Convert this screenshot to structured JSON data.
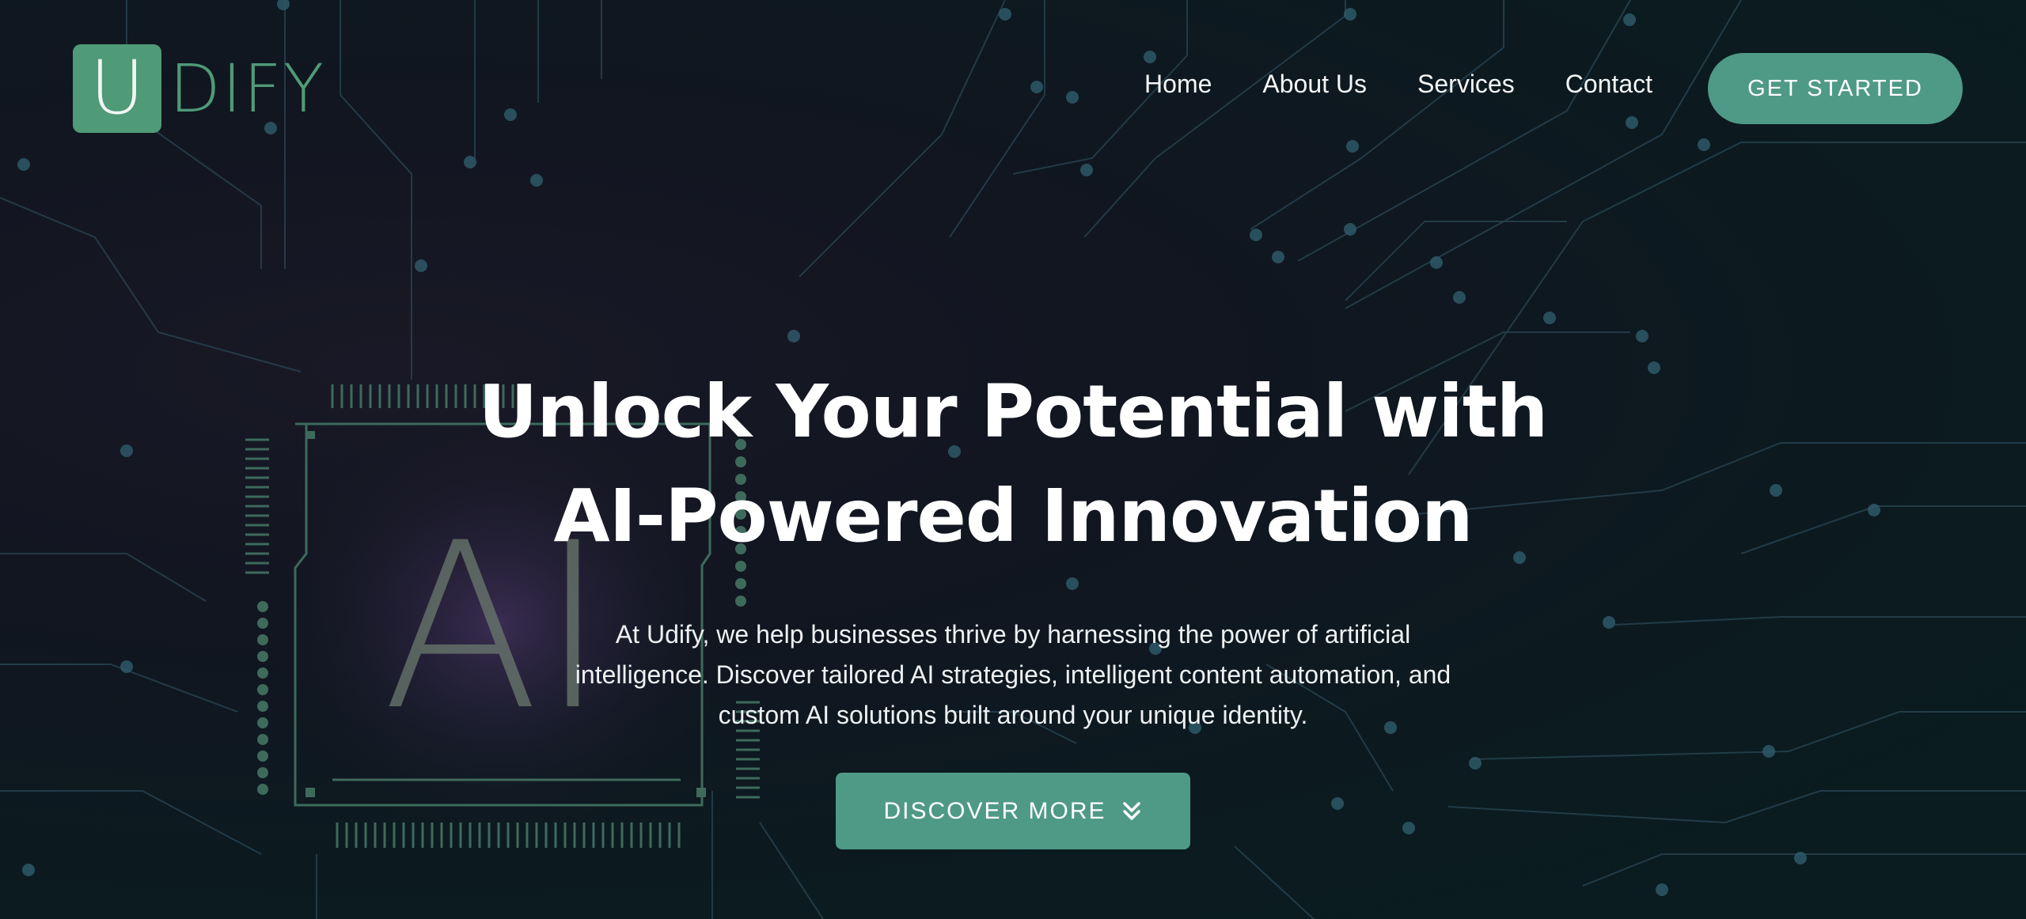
{
  "brand": {
    "logo_letter": "U",
    "logo_rest": "DIFY",
    "accent": "#4f9a87"
  },
  "nav": {
    "items": [
      {
        "label": "Home"
      },
      {
        "label": "About Us"
      },
      {
        "label": "Services"
      },
      {
        "label": "Contact"
      }
    ],
    "cta_label": "GET STARTED"
  },
  "hero": {
    "title_line1": "Unlock Your Potential with",
    "title_line2": "AI-Powered Innovation",
    "description_line1": "At Udify, we help businesses thrive by harnessing the power of artificial",
    "description_line2": "intelligence. Discover tailored AI strategies, intelligent content automation, and",
    "description_line3": "custom AI solutions built around your unique identity.",
    "button_label": "DISCOVER MORE",
    "button_icon": "double-chevron-down-icon"
  },
  "background": {
    "chip_text": "AI"
  }
}
